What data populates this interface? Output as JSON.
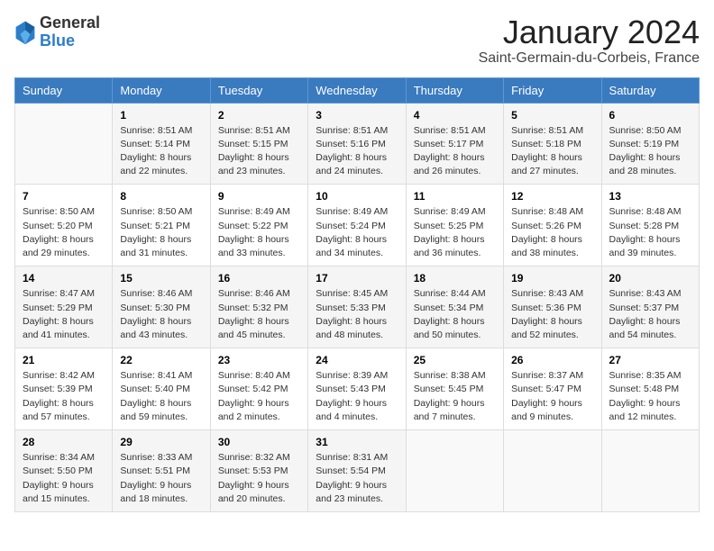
{
  "logo": {
    "text_general": "General",
    "text_blue": "Blue"
  },
  "title": "January 2024",
  "subtitle": "Saint-Germain-du-Corbeis, France",
  "calendar": {
    "headers": [
      "Sunday",
      "Monday",
      "Tuesday",
      "Wednesday",
      "Thursday",
      "Friday",
      "Saturday"
    ],
    "weeks": [
      [
        {
          "day": "",
          "content": ""
        },
        {
          "day": "1",
          "content": "Sunrise: 8:51 AM\nSunset: 5:14 PM\nDaylight: 8 hours\nand 22 minutes."
        },
        {
          "day": "2",
          "content": "Sunrise: 8:51 AM\nSunset: 5:15 PM\nDaylight: 8 hours\nand 23 minutes."
        },
        {
          "day": "3",
          "content": "Sunrise: 8:51 AM\nSunset: 5:16 PM\nDaylight: 8 hours\nand 24 minutes."
        },
        {
          "day": "4",
          "content": "Sunrise: 8:51 AM\nSunset: 5:17 PM\nDaylight: 8 hours\nand 26 minutes."
        },
        {
          "day": "5",
          "content": "Sunrise: 8:51 AM\nSunset: 5:18 PM\nDaylight: 8 hours\nand 27 minutes."
        },
        {
          "day": "6",
          "content": "Sunrise: 8:50 AM\nSunset: 5:19 PM\nDaylight: 8 hours\nand 28 minutes."
        }
      ],
      [
        {
          "day": "7",
          "content": "Sunrise: 8:50 AM\nSunset: 5:20 PM\nDaylight: 8 hours\nand 29 minutes."
        },
        {
          "day": "8",
          "content": "Sunrise: 8:50 AM\nSunset: 5:21 PM\nDaylight: 8 hours\nand 31 minutes."
        },
        {
          "day": "9",
          "content": "Sunrise: 8:49 AM\nSunset: 5:22 PM\nDaylight: 8 hours\nand 33 minutes."
        },
        {
          "day": "10",
          "content": "Sunrise: 8:49 AM\nSunset: 5:24 PM\nDaylight: 8 hours\nand 34 minutes."
        },
        {
          "day": "11",
          "content": "Sunrise: 8:49 AM\nSunset: 5:25 PM\nDaylight: 8 hours\nand 36 minutes."
        },
        {
          "day": "12",
          "content": "Sunrise: 8:48 AM\nSunset: 5:26 PM\nDaylight: 8 hours\nand 38 minutes."
        },
        {
          "day": "13",
          "content": "Sunrise: 8:48 AM\nSunset: 5:28 PM\nDaylight: 8 hours\nand 39 minutes."
        }
      ],
      [
        {
          "day": "14",
          "content": "Sunrise: 8:47 AM\nSunset: 5:29 PM\nDaylight: 8 hours\nand 41 minutes."
        },
        {
          "day": "15",
          "content": "Sunrise: 8:46 AM\nSunset: 5:30 PM\nDaylight: 8 hours\nand 43 minutes."
        },
        {
          "day": "16",
          "content": "Sunrise: 8:46 AM\nSunset: 5:32 PM\nDaylight: 8 hours\nand 45 minutes."
        },
        {
          "day": "17",
          "content": "Sunrise: 8:45 AM\nSunset: 5:33 PM\nDaylight: 8 hours\nand 48 minutes."
        },
        {
          "day": "18",
          "content": "Sunrise: 8:44 AM\nSunset: 5:34 PM\nDaylight: 8 hours\nand 50 minutes."
        },
        {
          "day": "19",
          "content": "Sunrise: 8:43 AM\nSunset: 5:36 PM\nDaylight: 8 hours\nand 52 minutes."
        },
        {
          "day": "20",
          "content": "Sunrise: 8:43 AM\nSunset: 5:37 PM\nDaylight: 8 hours\nand 54 minutes."
        }
      ],
      [
        {
          "day": "21",
          "content": "Sunrise: 8:42 AM\nSunset: 5:39 PM\nDaylight: 8 hours\nand 57 minutes."
        },
        {
          "day": "22",
          "content": "Sunrise: 8:41 AM\nSunset: 5:40 PM\nDaylight: 8 hours\nand 59 minutes."
        },
        {
          "day": "23",
          "content": "Sunrise: 8:40 AM\nSunset: 5:42 PM\nDaylight: 9 hours\nand 2 minutes."
        },
        {
          "day": "24",
          "content": "Sunrise: 8:39 AM\nSunset: 5:43 PM\nDaylight: 9 hours\nand 4 minutes."
        },
        {
          "day": "25",
          "content": "Sunrise: 8:38 AM\nSunset: 5:45 PM\nDaylight: 9 hours\nand 7 minutes."
        },
        {
          "day": "26",
          "content": "Sunrise: 8:37 AM\nSunset: 5:47 PM\nDaylight: 9 hours\nand 9 minutes."
        },
        {
          "day": "27",
          "content": "Sunrise: 8:35 AM\nSunset: 5:48 PM\nDaylight: 9 hours\nand 12 minutes."
        }
      ],
      [
        {
          "day": "28",
          "content": "Sunrise: 8:34 AM\nSunset: 5:50 PM\nDaylight: 9 hours\nand 15 minutes."
        },
        {
          "day": "29",
          "content": "Sunrise: 8:33 AM\nSunset: 5:51 PM\nDaylight: 9 hours\nand 18 minutes."
        },
        {
          "day": "30",
          "content": "Sunrise: 8:32 AM\nSunset: 5:53 PM\nDaylight: 9 hours\nand 20 minutes."
        },
        {
          "day": "31",
          "content": "Sunrise: 8:31 AM\nSunset: 5:54 PM\nDaylight: 9 hours\nand 23 minutes."
        },
        {
          "day": "",
          "content": ""
        },
        {
          "day": "",
          "content": ""
        },
        {
          "day": "",
          "content": ""
        }
      ]
    ]
  }
}
